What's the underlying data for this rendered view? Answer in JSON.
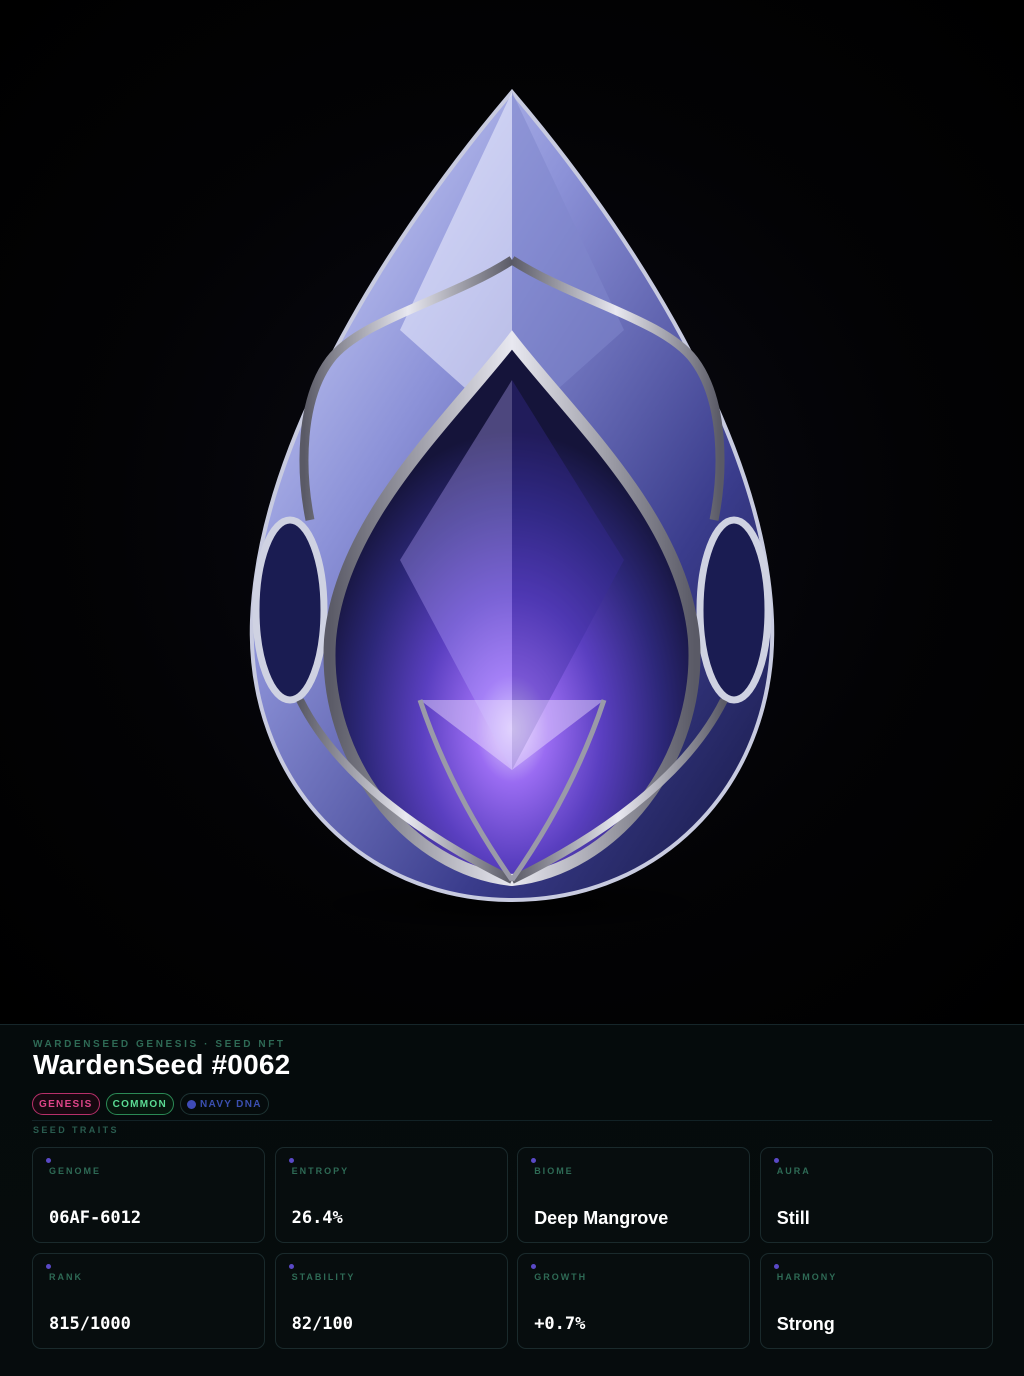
{
  "header": {
    "eyebrow": "WARDENSEED GENESIS · SEED NFT",
    "title": "WardenSeed #0062"
  },
  "badges": [
    {
      "label": "GENESIS",
      "color": "#e0458a"
    },
    {
      "label": "COMMON",
      "color": "#5bdc94"
    },
    {
      "label": "NAVY DNA",
      "color": "#3b4fb0"
    }
  ],
  "traits_section_label": "SEED TRAITS",
  "traits": [
    {
      "label": "GENOME",
      "value": "06AF-6012"
    },
    {
      "label": "ENTROPY",
      "value": "26.4%"
    },
    {
      "label": "BIOME",
      "value": "Deep Mangrove"
    },
    {
      "label": "AURA",
      "value": "Still"
    },
    {
      "label": "RANK",
      "value": "815/1000"
    },
    {
      "label": "STABILITY",
      "value": "82/100"
    },
    {
      "label": "GROWTH",
      "value": "+0.7%"
    },
    {
      "label": "HARMONY",
      "value": "Strong"
    }
  ],
  "hero_image": {
    "subject": "gem-seed",
    "accent": "#6a4be0"
  }
}
